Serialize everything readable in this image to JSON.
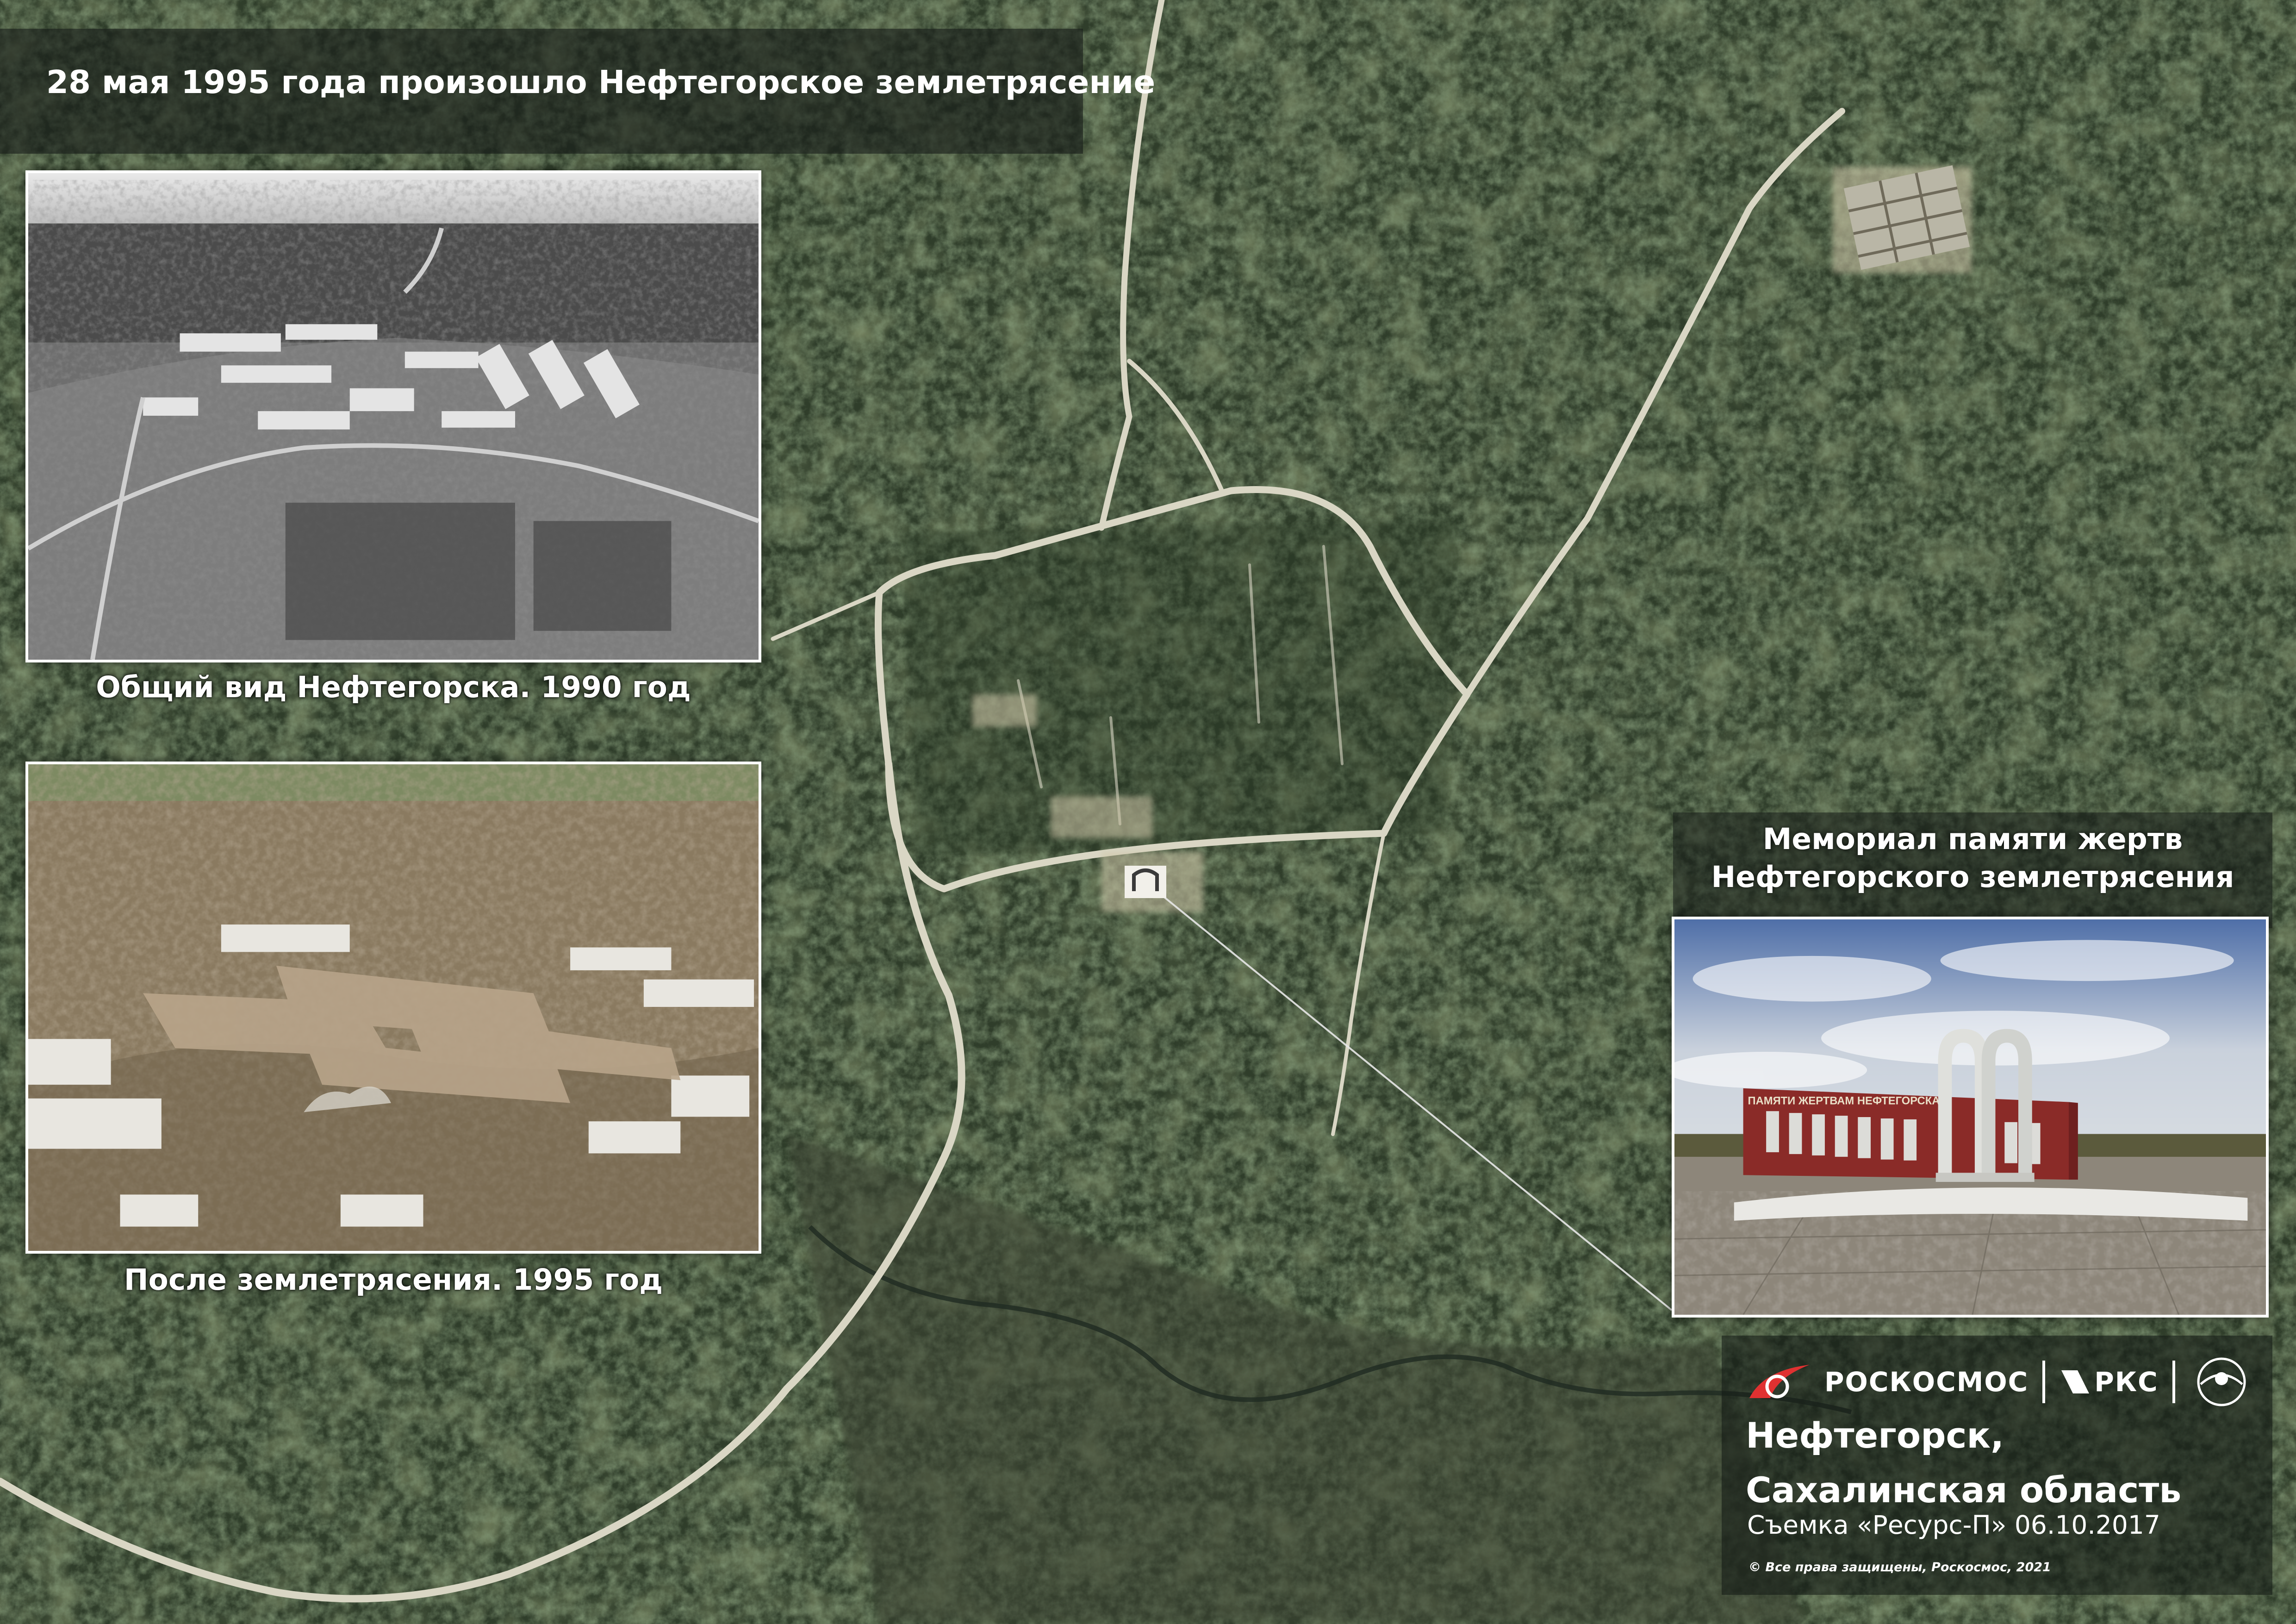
{
  "header": {
    "title": "28 мая 1995 года произошло Нефтегорское землетрясение"
  },
  "photos": [
    {
      "caption": "Общий вид Нефтегорска. 1990 год"
    },
    {
      "caption": "После землетрясения. 1995 год"
    },
    {
      "caption_line1": "Мемориал памяти жертв",
      "caption_line2": "Нефтегорского землетрясения",
      "inscription": "ПАМЯТИ ЖЕРТВАМ НЕФТЕГОРСКА"
    }
  ],
  "map": {
    "memorial_marker": "memorial-location-marker"
  },
  "footer": {
    "brand_roscosmos": "РОСКОСМОС",
    "brand_rks": "РКС",
    "place_line1": "Нефтегорск,",
    "place_line2": "Сахалинская область",
    "shot_info": "Съемка «Ресурс-П» 06.10.2017",
    "copyright": "© Все права защищены, Роскосмос, 2021"
  },
  "icons": [
    "roscosmos-logo-icon",
    "rks-logo-icon",
    "ntz-ops-emblem-icon",
    "memorial-marker-icon"
  ],
  "colors": {
    "forest": "#2f3f2a",
    "road": "#d9d6c4",
    "panel": "#161c18",
    "text": "#ffffff"
  }
}
